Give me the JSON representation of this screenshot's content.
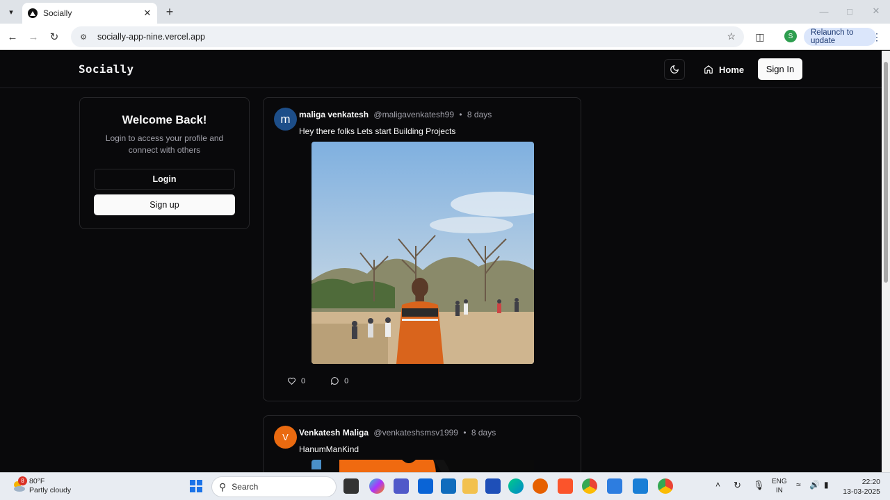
{
  "browser": {
    "tab_title": "Socially",
    "url": "socially-app-nine.vercel.app",
    "relaunch_label": "Relaunch to update",
    "profile_initial": "S"
  },
  "app": {
    "brand": "Socially",
    "nav": {
      "home_label": "Home",
      "signin_label": "Sign In"
    },
    "welcome": {
      "title": "Welcome Back!",
      "subtitle": "Login to access your profile and connect with others",
      "login_label": "Login",
      "signup_label": "Sign up"
    },
    "posts": [
      {
        "avatar_letter": "m",
        "author": "maliga venkatesh",
        "handle": "@maligavenkatesh99",
        "separator": "•",
        "age": "8 days",
        "content": "Hey there folks Lets start Building Projects",
        "likes": "0",
        "comments": "0"
      },
      {
        "avatar_letter": "V",
        "author": "Venkatesh Maliga",
        "handle": "@venkateshsmsv1999",
        "separator": "•",
        "age": "8 days",
        "content": "HanumManKind"
      }
    ]
  },
  "taskbar": {
    "weather_temp": "80°F",
    "weather_desc": "Partly cloudy",
    "weather_badge": "8",
    "search_label": "Search",
    "lang_top": "ENG",
    "lang_bottom": "IN",
    "time": "22:20",
    "date": "13-03-2025"
  },
  "colors": {
    "page_bg": "#09090b",
    "border": "#27272a",
    "post1_avatar": "#1d4e89",
    "post2_avatar": "#ea6a10"
  }
}
